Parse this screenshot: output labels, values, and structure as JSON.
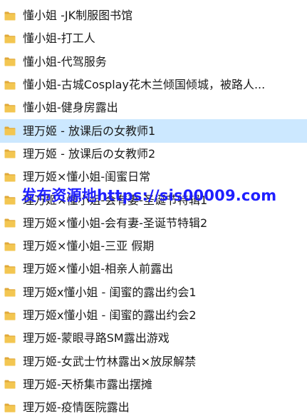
{
  "files": [
    {
      "name": "懂小姐 -JK制服图书馆",
      "icon": "folder-icon"
    },
    {
      "name": "懂小姐-打工人",
      "icon": "folder-icon"
    },
    {
      "name": "懂小姐-代驾服务",
      "icon": "folder-icon"
    },
    {
      "name": "懂小姐-古城Cosplay花木兰倾国倾城，被路人...",
      "icon": "folder-icon"
    },
    {
      "name": "懂小姐-健身房露出",
      "icon": "folder-icon"
    },
    {
      "name": "理万姬 - 放课后の女教师1",
      "icon": "folder-icon"
    },
    {
      "name": "理万姬 - 放课后の女教师2",
      "icon": "folder-icon"
    },
    {
      "name": "理万姬×懂小姐-闺蜜日常",
      "icon": "folder-icon"
    },
    {
      "name": "理万姬×懂小姐-会有妻-圣诞节特辑1",
      "icon": "folder-icon"
    },
    {
      "name": "理万姬×懂小姐-会有妻-圣诞节特辑2",
      "icon": "folder-icon"
    },
    {
      "name": "理万姬×懂小姐-三亚 假期",
      "icon": "folder-icon"
    },
    {
      "name": "理万姬×懂小姐-相亲人前露出",
      "icon": "folder-icon"
    },
    {
      "name": "理万姬x懂小姐 - 闺蜜的露出约会1",
      "icon": "folder-icon"
    },
    {
      "name": "理万姬x懂小姐 - 闺蜜的露出约会2",
      "icon": "folder-icon"
    },
    {
      "name": "理万姬-蒙眼寻路SM露出游戏",
      "icon": "folder-icon"
    },
    {
      "name": "理万姬-女武士竹林露出×放尿解禁",
      "icon": "folder-icon"
    },
    {
      "name": "理万姬-天桥集市露出摆摊",
      "icon": "folder-icon"
    },
    {
      "name": "理万姬-疫情医院露出",
      "icon": "folder-icon"
    }
  ],
  "selected_index": 5,
  "watermark": "发布资源地https://sis00009.com",
  "colors": {
    "folder": "#f3c651",
    "folder_dark": "#e0a93a",
    "selected_bg": "#cce8ff",
    "watermark": "#1f1fff"
  }
}
